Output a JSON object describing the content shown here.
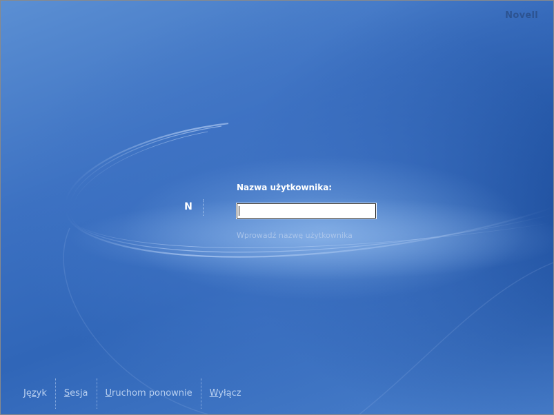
{
  "branding": {
    "vendor_name": "Novell",
    "logo_letter": "N"
  },
  "login": {
    "field_label": "Nazwa użytkownika:",
    "username_value": "",
    "hint_text": "Wprowadź nazwę użytkownika"
  },
  "bottom_menu": {
    "items": [
      {
        "pre": "Ję",
        "accel": "z",
        "post": "yk",
        "label": "Język"
      },
      {
        "pre": "",
        "accel": "S",
        "post": "esja",
        "label": "Sesja"
      },
      {
        "pre": "",
        "accel": "U",
        "post": "ruchom ponownie",
        "label": "Uruchom ponownie"
      },
      {
        "pre": "",
        "accel": "W",
        "post": "yłącz",
        "label": "Wyłącz"
      }
    ]
  },
  "colors": {
    "background_primary": "#3c71c2",
    "background_light": "#6a9ee0",
    "label_text": "#ffffff",
    "hint_text": "#a9c4ea",
    "menu_text": "#b9d0f0",
    "brand_text": "#2a4f8a"
  }
}
